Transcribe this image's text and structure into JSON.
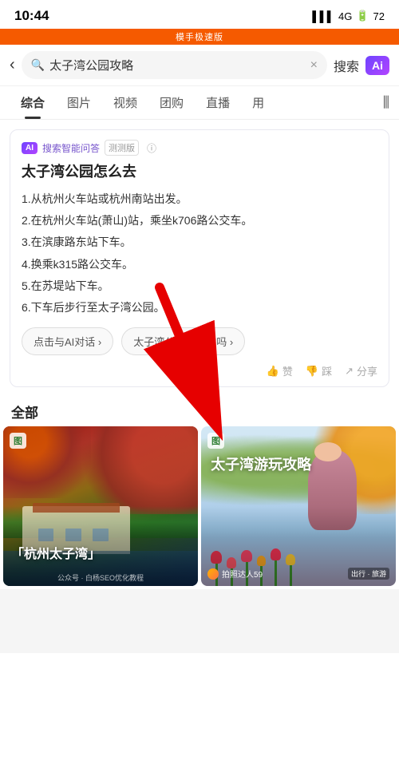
{
  "statusBar": {
    "time": "10:44",
    "network": "4G",
    "battery": "72",
    "watermark": "模手极速版"
  },
  "searchBar": {
    "query": "太子湾公园攻略",
    "searchBtnLabel": "搜索",
    "aiBadgeLabel": "Ai",
    "backIcon": "‹"
  },
  "tabs": [
    {
      "id": "comprehensive",
      "label": "综合",
      "active": true
    },
    {
      "id": "images",
      "label": "图片",
      "active": false
    },
    {
      "id": "videos",
      "label": "视频",
      "active": false
    },
    {
      "id": "groupbuy",
      "label": "团购",
      "active": false
    },
    {
      "id": "live",
      "label": "直播",
      "active": false
    },
    {
      "id": "more",
      "label": "用",
      "active": false
    }
  ],
  "aiCard": {
    "logoLabel": "AI",
    "headerLabel": "搜索智能问答",
    "betaLabel": "测测版",
    "infoIcon": "ⓘ",
    "title": "太子湾公园怎么去",
    "steps": [
      "1.从杭州火车站或杭州南站出发。",
      "2.在杭州火车站(萧山)站，乘坐k706路公交车。",
      "3.在滨康路东站下车。",
      "4.换乘k315路公交车。",
      "5.在苏堤站下车。",
      "6.下车后步行至太子湾公园。"
    ],
    "actionButtons": [
      {
        "label": "点击与AI对话 ›"
      },
      {
        "label": "太子湾公园要预约吗 ›"
      }
    ],
    "feedback": [
      {
        "icon": "👍",
        "label": "赞"
      },
      {
        "icon": "👎",
        "label": "踩"
      },
      {
        "icon": "↗",
        "label": "分享"
      }
    ]
  },
  "sectionHeader": "全部",
  "imageCards": [
    {
      "id": "card1",
      "topIcon": "图",
      "title": "「杭州太子湾」",
      "subtitle": "",
      "watermark": "公众号 · 白杨SEO优化教程"
    },
    {
      "id": "card2",
      "topIcon": "图",
      "title": "太子湾游玩攻略",
      "metaName": "拍照达人59",
      "metaTag": "出行 · 旅游"
    }
  ]
}
